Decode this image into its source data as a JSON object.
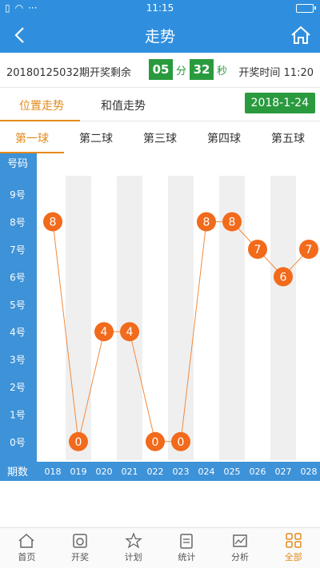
{
  "status_bar": {
    "time": "11:15",
    "dots": "···"
  },
  "nav": {
    "title": "走势"
  },
  "info": {
    "issue_text": "20180125032期开奖剩余",
    "minutes": "05",
    "minutes_unit": "分",
    "seconds": "32",
    "seconds_unit": "秒",
    "open_time": "开奖时间 11:20"
  },
  "tabs": {
    "position_trend": "位置走势",
    "sum_trend": "和值走势",
    "date": "2018-1-24"
  },
  "balls": [
    "第一球",
    "第二球",
    "第三球",
    "第四球",
    "第五球"
  ],
  "chart_data": {
    "type": "line",
    "row_header": "号码",
    "col_header": "期数",
    "row_labels": [
      "9号",
      "8号",
      "7号",
      "6号",
      "5号",
      "4号",
      "3号",
      "2号",
      "1号",
      "0号"
    ],
    "x": [
      "018",
      "019",
      "020",
      "021",
      "022",
      "023",
      "024",
      "025",
      "026",
      "027",
      "028"
    ],
    "values": [
      8,
      0,
      4,
      4,
      0,
      0,
      8,
      8,
      7,
      6,
      7
    ],
    "ylim": [
      0,
      9
    ],
    "colors": {
      "line": "#f28a3c",
      "node": "#f26a1b",
      "axis_bg": "#3d92d8",
      "stripe": "#efefef"
    }
  },
  "bottom_nav": [
    "首页",
    "开奖",
    "计划",
    "统计",
    "分析",
    "全部"
  ]
}
